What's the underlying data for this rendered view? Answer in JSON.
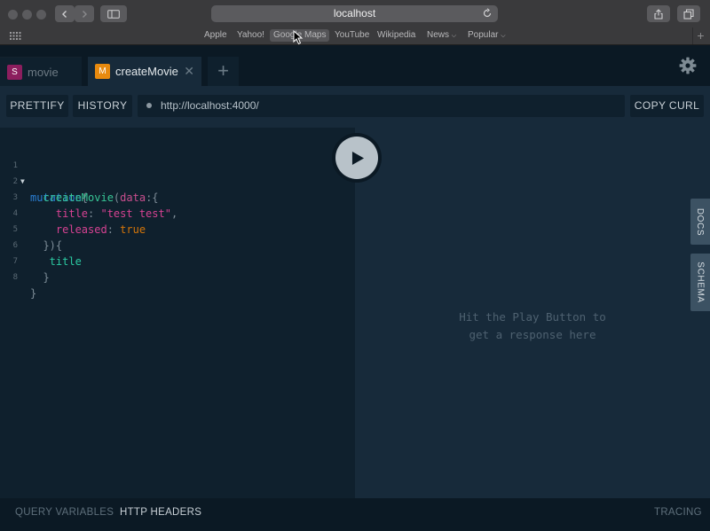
{
  "browser": {
    "url": "localhost",
    "favorites": [
      "Apple",
      "Yahoo!",
      "Google Maps",
      "YouTube",
      "Wikipedia",
      "News",
      "Popular"
    ]
  },
  "tabs": [
    {
      "badge": "S",
      "label": "movie",
      "badge_color": "#8c1e5e"
    },
    {
      "badge": "M",
      "label": "createMovie",
      "badge_color": "#e88a0e"
    }
  ],
  "toolbar": {
    "prettify": "PRETTIFY",
    "history": "HISTORY",
    "endpoint": "http://localhost:4000/",
    "copy_curl": "COPY CURL"
  },
  "editor": {
    "line_numbers": [
      "1",
      "2",
      "3",
      "4",
      "5",
      "6",
      "7",
      "8"
    ],
    "lines": [
      [
        {
          "t": "mutation",
          "c": "k"
        },
        {
          "t": "{",
          "c": "p"
        }
      ],
      [
        {
          "t": "  createMovie",
          "c": "f"
        },
        {
          "t": "(",
          "c": "p"
        },
        {
          "t": "data",
          "c": "a"
        },
        {
          "t": ":{",
          "c": "p"
        }
      ],
      [
        {
          "t": "    title",
          "c": "s"
        },
        {
          "t": ": ",
          "c": "p"
        },
        {
          "t": "\"test test\"",
          "c": "s"
        },
        {
          "t": ",",
          "c": "p"
        }
      ],
      [
        {
          "t": "    released",
          "c": "s"
        },
        {
          "t": ": ",
          "c": "p"
        },
        {
          "t": "true",
          "c": "b"
        }
      ],
      [
        {
          "t": "  }){",
          "c": "p"
        }
      ],
      [
        {
          "t": "   title",
          "c": "pl"
        }
      ],
      [
        {
          "t": "  }",
          "c": "p"
        }
      ],
      [
        {
          "t": "}",
          "c": "p"
        }
      ]
    ]
  },
  "result": {
    "hint_line1": "Hit the Play Button to",
    "hint_line2": "get a response here",
    "docs": "DOCS",
    "schema": "SCHEMA"
  },
  "bottom": {
    "query_variables": "QUERY VARIABLES",
    "http_headers": "HTTP HEADERS",
    "tracing": "TRACING"
  }
}
